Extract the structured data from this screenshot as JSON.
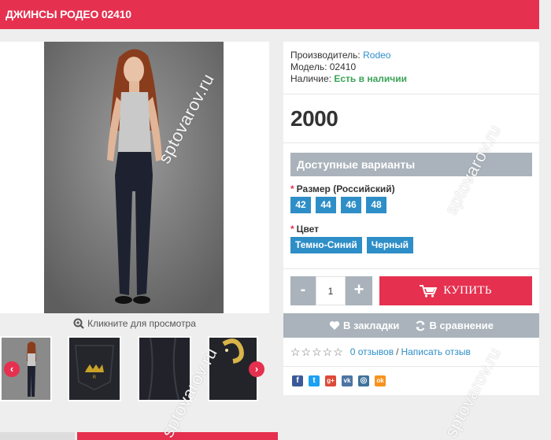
{
  "page": {
    "title": "ДЖИНСЫ РОДЕО 02410"
  },
  "gallery": {
    "zoom_hint": "Кликните для просмотра",
    "prev_arrow": "‹",
    "next_arrow": "›"
  },
  "info": {
    "manufacturer_label": "Производитель:",
    "manufacturer_value": "Rodeo",
    "model_label": "Модель:",
    "model_value": "02410",
    "availability_label": "Наличие:",
    "availability_value": "Есть в наличии"
  },
  "price": "2000",
  "variants": {
    "header": "Доступные варианты",
    "size_label": "Размер (Российский)",
    "sizes": [
      "42",
      "44",
      "46",
      "48"
    ],
    "color_label": "Цвет",
    "colors": [
      "Темно-Синий",
      "Черный"
    ],
    "required_mark": "*"
  },
  "cart": {
    "minus": "-",
    "quantity": "1",
    "plus": "+",
    "buy_label": "КУПИТЬ"
  },
  "actions": {
    "bookmark": "В закладки",
    "compare": "В сравнение"
  },
  "reviews": {
    "stars": "☆☆☆☆☆",
    "count": "0 отзывов",
    "separator": "/",
    "write": "Написать отзыв"
  },
  "social": [
    {
      "icon": "facebook-icon",
      "glyph": "f",
      "color": "#3b5998"
    },
    {
      "icon": "twitter-icon",
      "glyph": "t",
      "color": "#1da1f2"
    },
    {
      "icon": "googleplus-icon",
      "glyph": "g+",
      "color": "#dd4b39"
    },
    {
      "icon": "vk-icon",
      "glyph": "vk",
      "color": "#4c75a3"
    },
    {
      "icon": "instagram-icon",
      "glyph": "◎",
      "color": "#3f729b"
    },
    {
      "icon": "odnoklassniki-icon",
      "glyph": "ok",
      "color": "#f7931e"
    }
  ],
  "watermark": "sptovarov.ru",
  "colors": {
    "accent": "#e5304f",
    "option_blue": "#2e8ec7",
    "bar_gray": "#aab3bb",
    "stock_green": "#3aa356"
  }
}
